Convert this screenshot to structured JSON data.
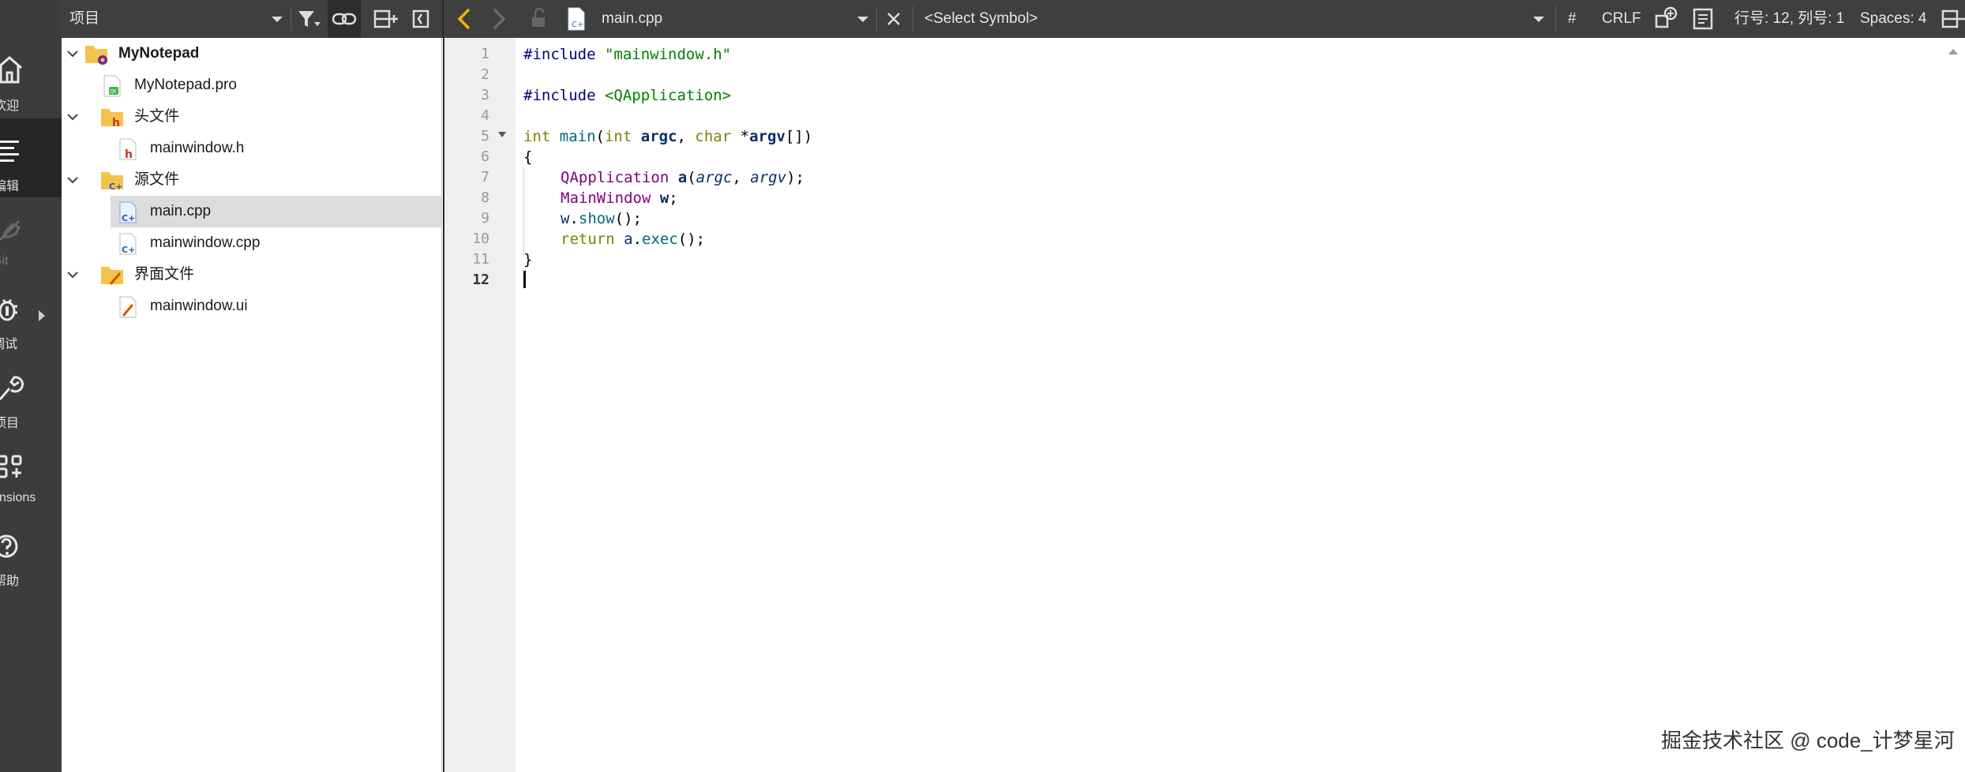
{
  "sidebar": {
    "modes": [
      {
        "label": "欢迎",
        "icon": "home-icon"
      },
      {
        "label": "编辑",
        "icon": "edit-icon"
      },
      {
        "label": "Git",
        "icon": "git-icon"
      },
      {
        "label": "调试",
        "icon": "debug-icon"
      },
      {
        "label": "项目",
        "icon": "wrench-icon"
      },
      {
        "label": "Extensions",
        "icon": "extensions-icon"
      },
      {
        "label": "帮助",
        "icon": "help-icon"
      }
    ],
    "visible_labels": [
      "欢迎",
      "编辑",
      "Git",
      "调试",
      "项目",
      "nsions",
      "帮助"
    ]
  },
  "toolbar": {
    "view_selector": "项目",
    "file_name": "main.cpp",
    "symbol_selector": "<Select Symbol>",
    "hash": "#",
    "line_ending": "CRLF",
    "cursor_position": "行号: 12, 列号: 1",
    "indent": "Spaces: 4"
  },
  "tree": {
    "items": [
      {
        "label": "MyNotepad",
        "type": "project",
        "expanded": true
      },
      {
        "label": "MyNotepad.pro",
        "type": "pro-file"
      },
      {
        "label": "头文件",
        "type": "folder-headers",
        "expanded": true
      },
      {
        "label": "mainwindow.h",
        "type": "header-file"
      },
      {
        "label": "源文件",
        "type": "folder-sources",
        "expanded": true
      },
      {
        "label": "main.cpp",
        "type": "cpp-file",
        "selected": true
      },
      {
        "label": "mainwindow.cpp",
        "type": "cpp-file"
      },
      {
        "label": "界面文件",
        "type": "folder-forms",
        "expanded": true
      },
      {
        "label": "mainwindow.ui",
        "type": "ui-file"
      }
    ]
  },
  "editor": {
    "line_numbers": [
      "1",
      "2",
      "3",
      "4",
      "5",
      "6",
      "7",
      "8",
      "9",
      "10",
      "11",
      "12"
    ],
    "current_line": 12,
    "code": {
      "l1a": "#include",
      "l1b": " \"mainwindow.h\"",
      "l3a": "#include",
      "l3b": " <QApplication>",
      "l5_int": "int",
      "l5_main": " main",
      "l5_p1": "(",
      "l5_int2": "int",
      "l5_argc": " argc",
      "l5_c": ", ",
      "l5_char": "char",
      "l5_star": " *",
      "l5_argv": "argv",
      "l5_end": "[])",
      "l6": "{",
      "l7_cls": "QApplication",
      "l7_sp": " ",
      "l7_a": "a",
      "l7_p": "(",
      "l7_argc": "argc",
      "l7_c": ", ",
      "l7_argv": "argv",
      "l7_end": ");",
      "l8_cls": "MainWindow",
      "l8_sp": " ",
      "l8_w": "w",
      "l8_end": ";",
      "l9_w": "w",
      "l9_dot": ".",
      "l9_show": "show",
      "l9_end": "();",
      "l10_ret": "return",
      "l10_sp": " ",
      "l10_a": "a",
      "l10_dot": ".",
      "l10_exec": "exec",
      "l10_end": "();",
      "l11": "}"
    }
  },
  "watermark": "掘金技术社区 @ code_计梦星河",
  "colors": {
    "mode_bar": "#3c3c3c",
    "toolbar": "#3d3f41",
    "selected_row": "#dcdcdc",
    "gutter": "#efefef",
    "back_arrow": "#f0b400",
    "string": "#008000",
    "keyword": "#808000",
    "preprocessor": "#000080",
    "class": "#800080"
  }
}
